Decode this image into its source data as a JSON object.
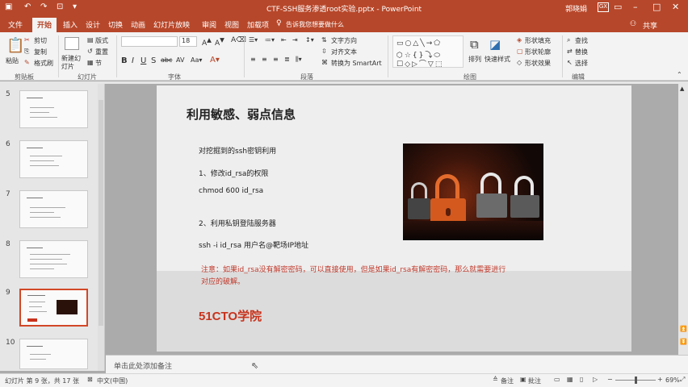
{
  "app": {
    "title": "CTF-SSH服务渗透root实验.pptx - PowerPoint",
    "user": "郭晓娟",
    "account_initials": "GX"
  },
  "tabs": [
    "文件",
    "开始",
    "插入",
    "设计",
    "切换",
    "动画",
    "幻灯片放映",
    "审阅",
    "视图",
    "加载项"
  ],
  "active_tab": "开始",
  "tell_me": "告诉我您想要做什么",
  "share": "共享",
  "ribbon": {
    "clipboard": {
      "paste": "粘贴",
      "cut": "剪切",
      "copy": "复制",
      "format_painter": "格式刷",
      "label": "剪贴板"
    },
    "slides": {
      "new_slide": "新建幻灯片",
      "layout": "版式",
      "reset": "重置",
      "section": "节",
      "label": "幻灯片"
    },
    "font": {
      "label": "字体",
      "size": "18"
    },
    "paragraph": {
      "text_direction": "文字方向",
      "align_text": "对齐文本",
      "convert_smartart": "转换为 SmartArt",
      "label": "段落"
    },
    "drawing": {
      "arrange": "排列",
      "quick_styles": "快速样式",
      "shape_fill": "形状填充",
      "shape_outline": "形状轮廓",
      "shape_effects": "形状效果",
      "label": "绘图"
    },
    "editing": {
      "find": "查找",
      "replace": "替换",
      "select": "选择",
      "label": "编辑"
    }
  },
  "thumbnails": [
    {
      "num": "5"
    },
    {
      "num": "6"
    },
    {
      "num": "7"
    },
    {
      "num": "8"
    },
    {
      "num": "9",
      "selected": true
    },
    {
      "num": "10"
    }
  ],
  "slide": {
    "title": "利用敏感、弱点信息",
    "line1": "对挖掘到的ssh密钥利用",
    "line2": "1、修改id_rsa的权限",
    "line3": "chmod 600 id_rsa",
    "line4": "2、利用私钥登陆服务器",
    "line5": "ssh -i id_rsa 用户名@靶场IP地址",
    "note_line1": "注意：如果id_rsa没有解密密码，可以直接使用，但是如果id_rsa有解密密码，那么就需要进行",
    "note_line2": "对应的破解。",
    "logo": "51CTO学院"
  },
  "notes_placeholder": "单击此处添加备注",
  "status": {
    "slide_info": "幻灯片 第 9 张，共 17 张",
    "language": "中文(中国)",
    "notes": "备注",
    "comments": "批注",
    "zoom": "69%"
  },
  "colors": {
    "accent": "#b7472a",
    "note_text": "#c0392b",
    "logo_red": "#c8321c"
  }
}
